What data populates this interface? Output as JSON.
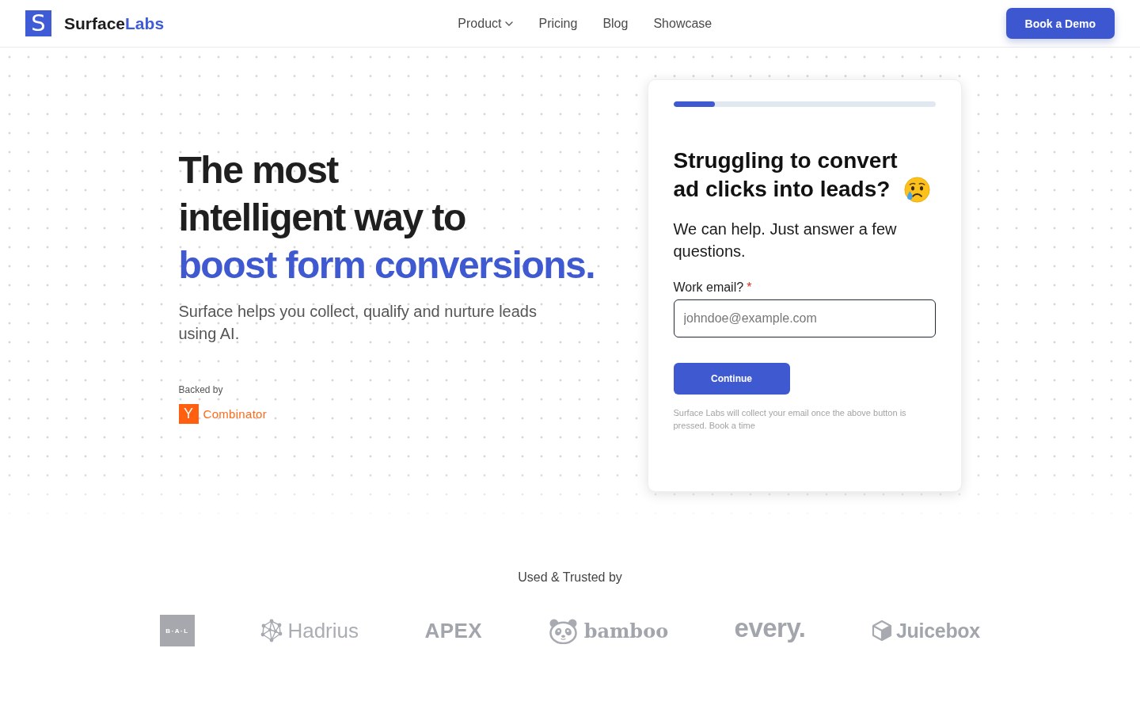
{
  "header": {
    "brand": {
      "mark": "S",
      "name": "Surface",
      "name_accent": "Labs"
    },
    "nav": [
      {
        "label": "Product",
        "kind": "dropdown"
      },
      {
        "label": "Pricing",
        "kind": "link"
      },
      {
        "label": "Blog",
        "kind": "link"
      },
      {
        "label": "Showcase",
        "kind": "link"
      }
    ],
    "cta": "Book a Demo"
  },
  "hero": {
    "title_lines": [
      "The most",
      "intelligent way to"
    ],
    "title_highlight": "boost form conversions.",
    "subtitle": "Surface helps you collect, qualify and nurture leads using AI.",
    "backed_by": {
      "label": "Backed by",
      "mark": "Y",
      "name": "Combinator"
    }
  },
  "form_card": {
    "progress": {
      "level": 0.16
    },
    "heading_lines": [
      "Struggling to convert",
      "ad clicks into leads?"
    ],
    "intro": "We can help. Just answer a few questions.",
    "field": {
      "label": "Work email?",
      "required_mark": "*",
      "placeholder": "johndoe@example.com"
    },
    "submit": "Continue",
    "disclaimer": "Surface Labs will collect your email once the above button is pressed. Book a time"
  },
  "trusted": {
    "heading": "Used & Trusted by",
    "logos": [
      {
        "kind": "tile",
        "text": "B·A·L"
      },
      {
        "kind": "network",
        "text": "Hadrius"
      },
      {
        "kind": "stencil",
        "text": "APEX"
      },
      {
        "kind": "panda",
        "text": "bamboo"
      },
      {
        "kind": "heavy",
        "text": "every."
      },
      {
        "kind": "cube",
        "text": "Juicebox"
      }
    ]
  }
}
